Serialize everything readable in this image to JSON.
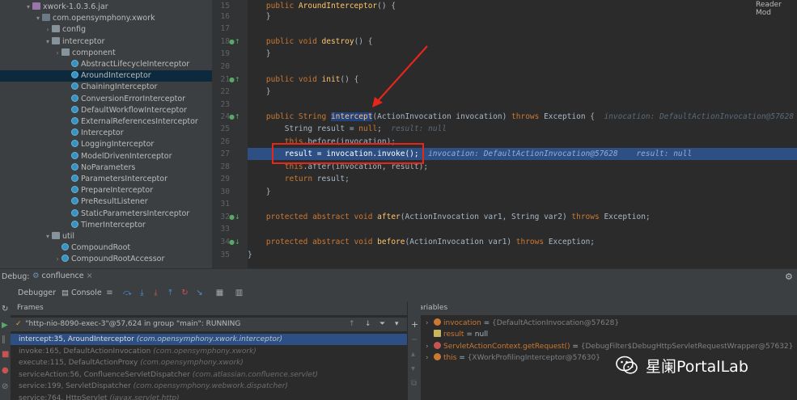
{
  "tree": {
    "items": [
      {
        "label": "xwork-1.0.3.6.jar",
        "type": "jar",
        "indent": 2,
        "expanded": true
      },
      {
        "label": "com.opensymphony.xwork",
        "type": "pkg",
        "indent": 3,
        "expanded": true
      },
      {
        "label": "config",
        "type": "folder",
        "indent": 4,
        "expanded": false
      },
      {
        "label": "interceptor",
        "type": "folder",
        "indent": 4,
        "expanded": true
      },
      {
        "label": "component",
        "type": "folder",
        "indent": 5,
        "expanded": false
      },
      {
        "label": "AbstractLifecycleInterceptor",
        "type": "class",
        "indent": 6
      },
      {
        "label": "AroundInterceptor",
        "type": "class",
        "indent": 6,
        "selected": true
      },
      {
        "label": "ChainingInterceptor",
        "type": "class",
        "indent": 6
      },
      {
        "label": "ConversionErrorInterceptor",
        "type": "class",
        "indent": 6
      },
      {
        "label": "DefaultWorkflowInterceptor",
        "type": "class",
        "indent": 6
      },
      {
        "label": "ExternalReferencesInterceptor",
        "type": "class",
        "indent": 6
      },
      {
        "label": "Interceptor",
        "type": "class",
        "indent": 6
      },
      {
        "label": "LoggingInterceptor",
        "type": "class",
        "indent": 6
      },
      {
        "label": "ModelDrivenInterceptor",
        "type": "class",
        "indent": 6
      },
      {
        "label": "NoParameters",
        "type": "class",
        "indent": 6
      },
      {
        "label": "ParametersInterceptor",
        "type": "class",
        "indent": 6
      },
      {
        "label": "PrepareInterceptor",
        "type": "class",
        "indent": 6
      },
      {
        "label": "PreResultListener",
        "type": "class",
        "indent": 6
      },
      {
        "label": "StaticParametersInterceptor",
        "type": "class",
        "indent": 6
      },
      {
        "label": "TimerInterceptor",
        "type": "class",
        "indent": 6
      },
      {
        "label": "util",
        "type": "folder",
        "indent": 4,
        "expanded": true
      },
      {
        "label": "CompoundRoot",
        "type": "class",
        "indent": 5
      },
      {
        "label": "CompoundRootAccessor",
        "type": "class",
        "indent": 5,
        "expandable": true
      }
    ]
  },
  "editor": {
    "reader_mode": "Reader Mod",
    "line_numbers": [
      "15",
      "16",
      "17",
      "18",
      "19",
      "20",
      "21",
      "22",
      "23",
      "24",
      "25",
      "26",
      "27",
      "28",
      "29",
      "30",
      "31",
      "32",
      "33",
      "34",
      "35"
    ],
    "lines": {
      "l15_pre": "    public ",
      "l15_fn": "AroundInterceptor",
      "l15_post": "() {",
      "l16": "    }",
      "l18_pre": "    public void ",
      "l18_fn": "destroy",
      "l18_post": "() {",
      "l19": "    }",
      "l21_pre": "    public void ",
      "l21_fn": "init",
      "l21_post": "() {",
      "l22": "    }",
      "l24_pre": "    public String ",
      "l24_sel": "intercept",
      "l24_post": "(ActionInvocation invocation) ",
      "l24_kw": "throws",
      "l24_tail": " Exception {",
      "l24_hint": "invocation: DefaultActionInvocation@57628",
      "l25_code": "        String result = ",
      "l25_kw": "null",
      "l25_semi": ";",
      "l25_hint": "result: null",
      "l26_kw": "        this",
      "l26_code": ".before(invocation);",
      "l27_code": "        result = invocation.invoke();",
      "l27_hint": "invocation: DefaultActionInvocation@57628    result: null",
      "l28_kw": "        this",
      "l28_code": ".after(invocation, result);",
      "l29_kw": "        return",
      "l29_code": " result;",
      "l30": "    }",
      "l32_kw": "    protected abstract void ",
      "l32_fn": "after",
      "l32_code": "(ActionInvocation var1, String var2) ",
      "l32_kw2": "throws",
      "l32_tail": " Exception;",
      "l34_kw": "    protected abstract void ",
      "l34_fn": "before",
      "l34_code": "(ActionInvocation var1) ",
      "l34_kw2": "throws",
      "l34_tail": " Exception;",
      "l35": "}"
    }
  },
  "debug": {
    "label": "Debug:",
    "session": "confluence",
    "tabs": {
      "debugger": "Debugger",
      "console": "Console"
    },
    "frames_title": "Frames",
    "variables_title": "Variables",
    "thread": "\"http-nio-8090-exec-3\"@57,624 in group \"main\": RUNNING",
    "frames": [
      {
        "method": "intercept:35, AroundInterceptor",
        "pkg": "(com.opensymphony.xwork.interceptor)",
        "selected": true
      },
      {
        "method": "invoke:165, DefaultActionInvocation",
        "pkg": "(com.opensymphony.xwork)"
      },
      {
        "method": "execute:115, DefaultActionProxy",
        "pkg": "(com.opensymphony.xwork)"
      },
      {
        "method": "serviceAction:56, ConfluenceServletDispatcher",
        "pkg": "(com.atlassian.confluence.servlet)"
      },
      {
        "method": "service:199, ServletDispatcher",
        "pkg": "(com.opensymphony.webwork.dispatcher)"
      },
      {
        "method": "service:764, HttpServlet",
        "pkg": "(javax.servlet.http)"
      }
    ],
    "variables": [
      {
        "name": "invocation",
        "eq": " = ",
        "value": "{DefaultActionInvocation@57628}",
        "icon": "f",
        "expandable": true
      },
      {
        "name": "result",
        "eq": " = ",
        "value": "null",
        "icon": "l",
        "expandable": false
      },
      {
        "name": "ServletActionContext.getRequest()",
        "eq": " = ",
        "value": "{DebugFilter$DebugHttpServletRequestWrapper@57632}",
        "icon": "m",
        "expandable": true
      },
      {
        "name": "this",
        "eq": " = ",
        "value": "{XWorkProfilingInterceptor@57630}",
        "icon": "f",
        "expandable": true
      }
    ]
  },
  "watermark": {
    "text": "星阑PortalLab"
  },
  "colors": {
    "accent_red": "#e5261b",
    "selection": "#2d4f84",
    "keyword": "#cc7832"
  }
}
